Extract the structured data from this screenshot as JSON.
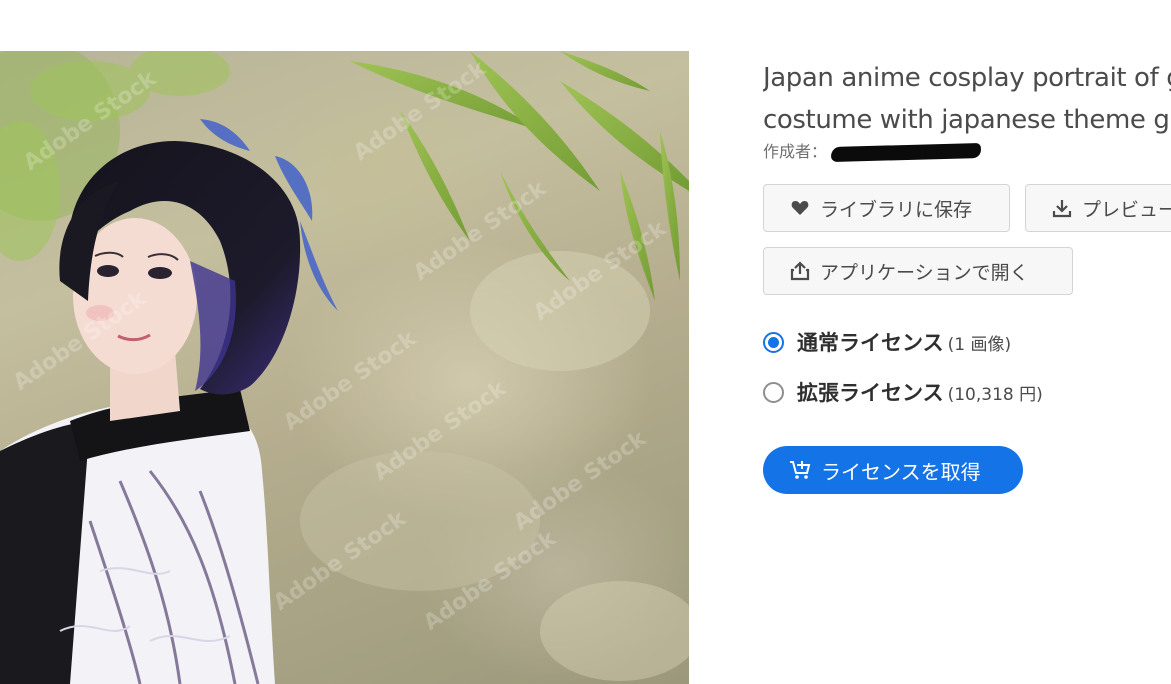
{
  "asset": {
    "title_lines": [
      "Japan anime cosplay portrait of g",
      "costume with japanese theme g"
    ],
    "author_label": "作成者："
  },
  "actions": {
    "save_label": "ライブラリに保存",
    "preview_label": "プレビュー",
    "open_in_app_label": "アプリケーションで開く"
  },
  "licenses": [
    {
      "name": "通常ライセンス",
      "note": "(1 画像)",
      "selected": true
    },
    {
      "name": "拡張ライセンス",
      "note": "(10,318 円)",
      "selected": false
    }
  ],
  "cta": {
    "label": "ライセンスを取得"
  },
  "photo": {
    "watermark": "Adobe Stock"
  },
  "icons": {
    "save": "heart-icon",
    "preview": "download-icon",
    "open": "share-icon",
    "cta": "cart-icon"
  },
  "colors": {
    "accent": "#1473e6",
    "button_bg": "#f7f7f7",
    "text": "#4b4b4b"
  }
}
